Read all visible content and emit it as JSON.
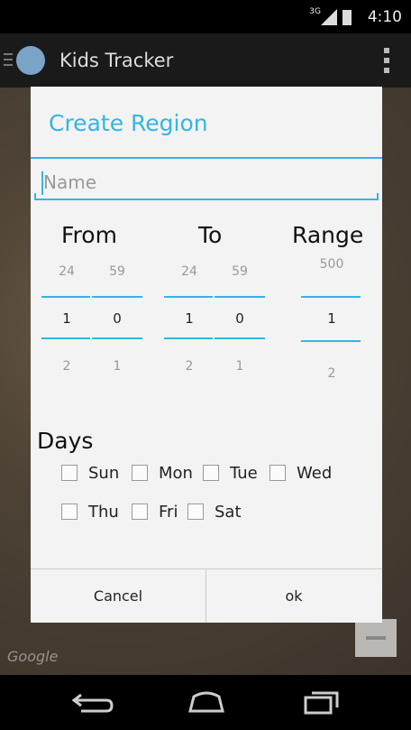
{
  "status": {
    "network": "3G",
    "time": "4:10"
  },
  "app": {
    "title": "Kids Tracker"
  },
  "map": {
    "attribution": "Google"
  },
  "dialog": {
    "title": "Create Region",
    "name_placeholder": "Name",
    "from": {
      "label": "From",
      "hours": {
        "prev": "24",
        "current": "1",
        "next": "2"
      },
      "minutes": {
        "prev": "59",
        "current": "0",
        "next": "1"
      }
    },
    "to": {
      "label": "To",
      "hours": {
        "prev": "24",
        "current": "1",
        "next": "2"
      },
      "minutes": {
        "prev": "59",
        "current": "0",
        "next": "1"
      }
    },
    "range": {
      "label": "Range",
      "prev": "500",
      "current": "1",
      "next": "2"
    },
    "days_label": "Days",
    "days": [
      {
        "label": "Sun",
        "checked": false
      },
      {
        "label": "Mon",
        "checked": false
      },
      {
        "label": "Tue",
        "checked": false
      },
      {
        "label": "Wed",
        "checked": false
      },
      {
        "label": "Thu",
        "checked": false
      },
      {
        "label": "Fri",
        "checked": false
      },
      {
        "label": "Sat",
        "checked": false
      }
    ],
    "cancel_label": "Cancel",
    "ok_label": "ok"
  }
}
